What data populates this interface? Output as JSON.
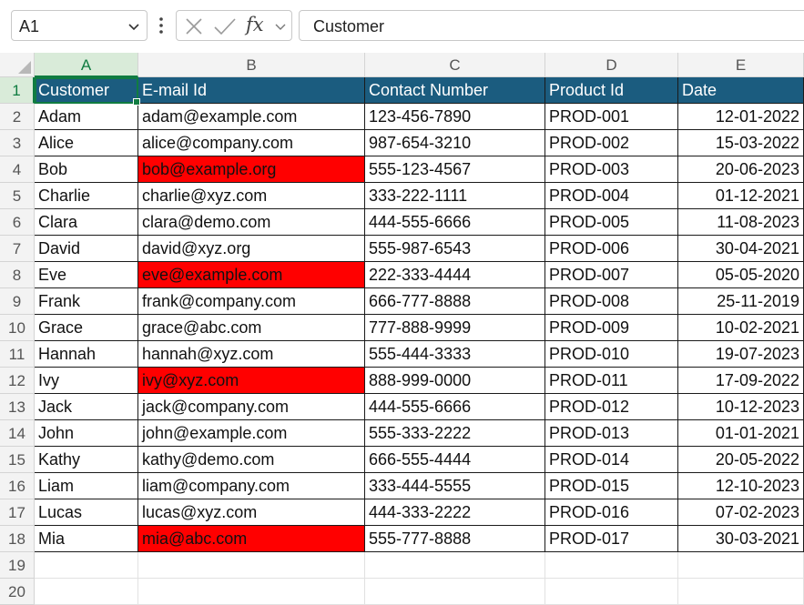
{
  "name_box": {
    "value": "A1"
  },
  "formula_bar": {
    "value": "Customer",
    "fx_label": "fx"
  },
  "columns": [
    "A",
    "B",
    "C",
    "D",
    "E"
  ],
  "rows": [
    "1",
    "2",
    "3",
    "4",
    "5",
    "6",
    "7",
    "8",
    "9",
    "10",
    "11",
    "12",
    "13",
    "14",
    "15",
    "16",
    "17",
    "18",
    "19",
    "20"
  ],
  "colors": {
    "header_fill": "#1b5c7f",
    "highlight_fill": "#ff0000",
    "selection": "#107c41"
  },
  "table": {
    "headers": [
      "Customer",
      "E-mail  Id",
      "Contact Number",
      "Product Id",
      "Date"
    ],
    "rows": [
      {
        "cells": [
          "Adam",
          "adam@example.com",
          "123-456-7890",
          "PROD-001",
          "12-01-2022"
        ],
        "email_highlight": false
      },
      {
        "cells": [
          "Alice",
          "alice@company.com",
          "987-654-3210",
          "PROD-002",
          "15-03-2022"
        ],
        "email_highlight": false
      },
      {
        "cells": [
          "Bob",
          "bob@example.org",
          "555-123-4567",
          "PROD-003",
          "20-06-2023"
        ],
        "email_highlight": true
      },
      {
        "cells": [
          "Charlie",
          "charlie@xyz.com",
          "333-222-1111",
          "PROD-004",
          "01-12-2021"
        ],
        "email_highlight": false
      },
      {
        "cells": [
          "Clara",
          "clara@demo.com",
          "444-555-6666",
          "PROD-005",
          "11-08-2023"
        ],
        "email_highlight": false
      },
      {
        "cells": [
          "David",
          "david@xyz.org",
          "555-987-6543",
          "PROD-006",
          "30-04-2021"
        ],
        "email_highlight": false
      },
      {
        "cells": [
          "Eve",
          "eve@example.com",
          "222-333-4444",
          "PROD-007",
          "05-05-2020"
        ],
        "email_highlight": true
      },
      {
        "cells": [
          "Frank",
          "frank@company.com",
          "666-777-8888",
          "PROD-008",
          "25-11-2019"
        ],
        "email_highlight": false
      },
      {
        "cells": [
          "Grace",
          "grace@abc.com",
          "777-888-9999",
          "PROD-009",
          "10-02-2021"
        ],
        "email_highlight": false
      },
      {
        "cells": [
          "Hannah",
          "hannah@xyz.com",
          "555-444-3333",
          "PROD-010",
          "19-07-2023"
        ],
        "email_highlight": false
      },
      {
        "cells": [
          "Ivy",
          "ivy@xyz.com",
          "888-999-0000",
          "PROD-011",
          "17-09-2022"
        ],
        "email_highlight": true
      },
      {
        "cells": [
          "Jack",
          "jack@company.com",
          "444-555-6666",
          "PROD-012",
          "10-12-2023"
        ],
        "email_highlight": false
      },
      {
        "cells": [
          "John",
          "john@example.com",
          "555-333-2222",
          "PROD-013",
          "01-01-2021"
        ],
        "email_highlight": false
      },
      {
        "cells": [
          "Kathy",
          "kathy@demo.com",
          "666-555-4444",
          "PROD-014",
          "20-05-2022"
        ],
        "email_highlight": false
      },
      {
        "cells": [
          "Liam",
          "liam@company.com",
          "333-444-5555",
          "PROD-015",
          "12-10-2023"
        ],
        "email_highlight": false
      },
      {
        "cells": [
          "Lucas",
          "lucas@xyz.com",
          "444-333-2222",
          "PROD-016",
          "07-02-2023"
        ],
        "email_highlight": false
      },
      {
        "cells": [
          "Mia",
          "mia@abc.com",
          "555-777-8888",
          "PROD-017",
          "30-03-2021"
        ],
        "email_highlight": true
      }
    ]
  }
}
